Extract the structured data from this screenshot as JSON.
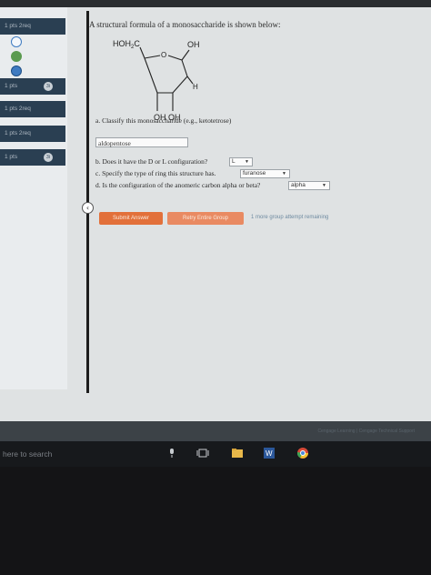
{
  "sidebar": {
    "items": [
      {
        "label": "1 pts   2req",
        "badge": ""
      },
      {
        "label": "1 pts",
        "badge": "3i"
      },
      {
        "label": "1 pts   2req",
        "badge": ""
      },
      {
        "label": "1 pts   2req",
        "badge": ""
      },
      {
        "label": "1 pts",
        "badge": "3i"
      }
    ]
  },
  "question": {
    "title": "A structural formula of a monosaccharide is shown below:",
    "structure": {
      "label_hoh2c": "HOH",
      "sub_2": "2",
      "label_c": "C",
      "label_o": "O",
      "label_oh_top": "OH",
      "label_h": "H",
      "label_oh_bottom": "OH  OH"
    },
    "part_a": "a. Classify this monosaccharide (e.g., ketotetrose)",
    "answer_a": "aldopentose",
    "part_b": "b. Does it have the D or L configuration?",
    "select_b": "L",
    "part_c": "c. Specify the type of ring this structure has.",
    "select_c": "furanose",
    "part_d": "d. Is the configuration of the anomeric carbon alpha or beta?",
    "select_d": "alpha",
    "dropdown_arrow": "▼"
  },
  "buttons": {
    "submit": "Submit Answer",
    "retry": "Retry Entire Group",
    "attempts": "1 more group attempt remaining"
  },
  "footer": {
    "copyright": "Cengage Learning  |  Cengage Technical Support"
  },
  "taskbar": {
    "search": "here to search"
  },
  "colors": {
    "sidebar_item": "#2a3f52",
    "submit": "#e2703a",
    "retry": "#e98a62",
    "attempts_text": "#6e8aa0"
  },
  "icons": [
    "check-circle-icon",
    "help-circle-icon",
    "collapse-arrow-icon",
    "microphone-icon",
    "task-view-icon",
    "file-explorer-icon",
    "word-icon",
    "chrome-icon"
  ]
}
